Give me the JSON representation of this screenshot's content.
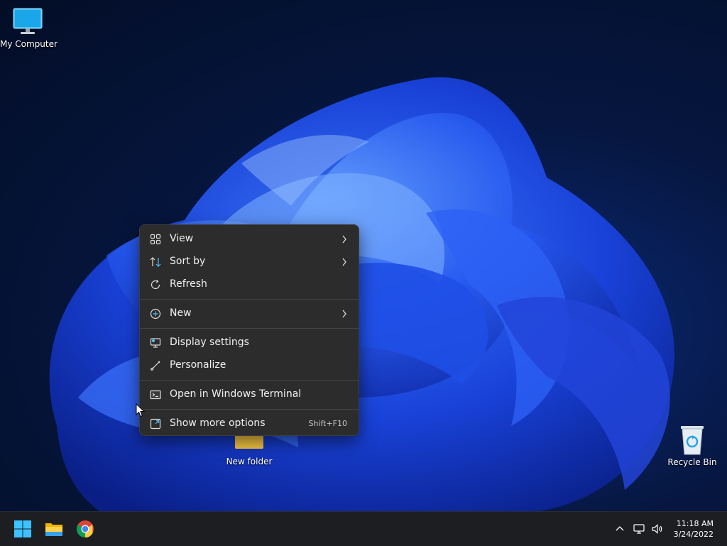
{
  "desktop": {
    "icons": {
      "my_computer": "My Computer",
      "new_folder": "New folder",
      "recycle_bin": "Recycle Bin"
    }
  },
  "context_menu": {
    "items": [
      {
        "label": "View",
        "icon": "grid-icon",
        "submenu": true
      },
      {
        "label": "Sort by",
        "icon": "sort-icon",
        "submenu": true
      },
      {
        "label": "Refresh",
        "icon": "refresh-icon",
        "submenu": false
      },
      {
        "label": "New",
        "icon": "plus-circle-icon",
        "submenu": true
      },
      {
        "label": "Display settings",
        "icon": "display-icon",
        "submenu": false
      },
      {
        "label": "Personalize",
        "icon": "brush-icon",
        "submenu": false
      },
      {
        "label": "Open in Windows Terminal",
        "icon": "terminal-icon",
        "submenu": false
      },
      {
        "label": "Show more options",
        "icon": "expand-icon",
        "shortcut": "Shift+F10"
      }
    ]
  },
  "taskbar": {
    "clock": {
      "time": "11:18 AM",
      "date": "3/24/2022"
    }
  },
  "colors": {
    "menu_bg": "#2c2c2c",
    "taskbar_bg": "#1c1e22",
    "accent": "#4cc2ff"
  }
}
